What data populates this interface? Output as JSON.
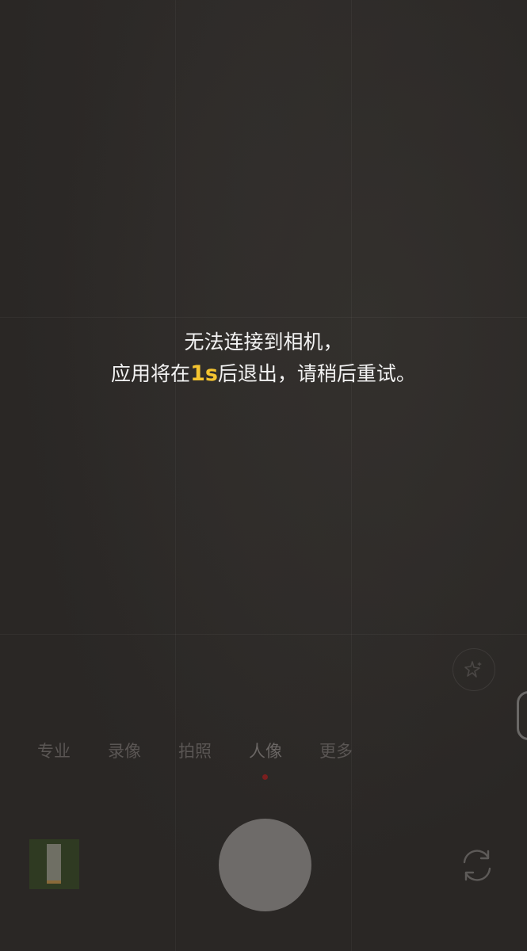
{
  "error": {
    "line1": "无法连接到相机，",
    "line2_prefix": "应用将在",
    "countdown": "1s",
    "line2_suffix": "后退出，请稍后重试。"
  },
  "modes": [
    {
      "label": "专业"
    },
    {
      "label": "录像"
    },
    {
      "label": "拍照"
    },
    {
      "label": "人像"
    },
    {
      "label": "更多"
    }
  ],
  "active_mode": "人像",
  "colors": {
    "countdown_highlight": "#f4c430",
    "mode_indicator": "#7a1f1f"
  },
  "icons": {
    "beauty": "sparkle-star-icon",
    "switch_camera": "switch-camera-icon"
  }
}
